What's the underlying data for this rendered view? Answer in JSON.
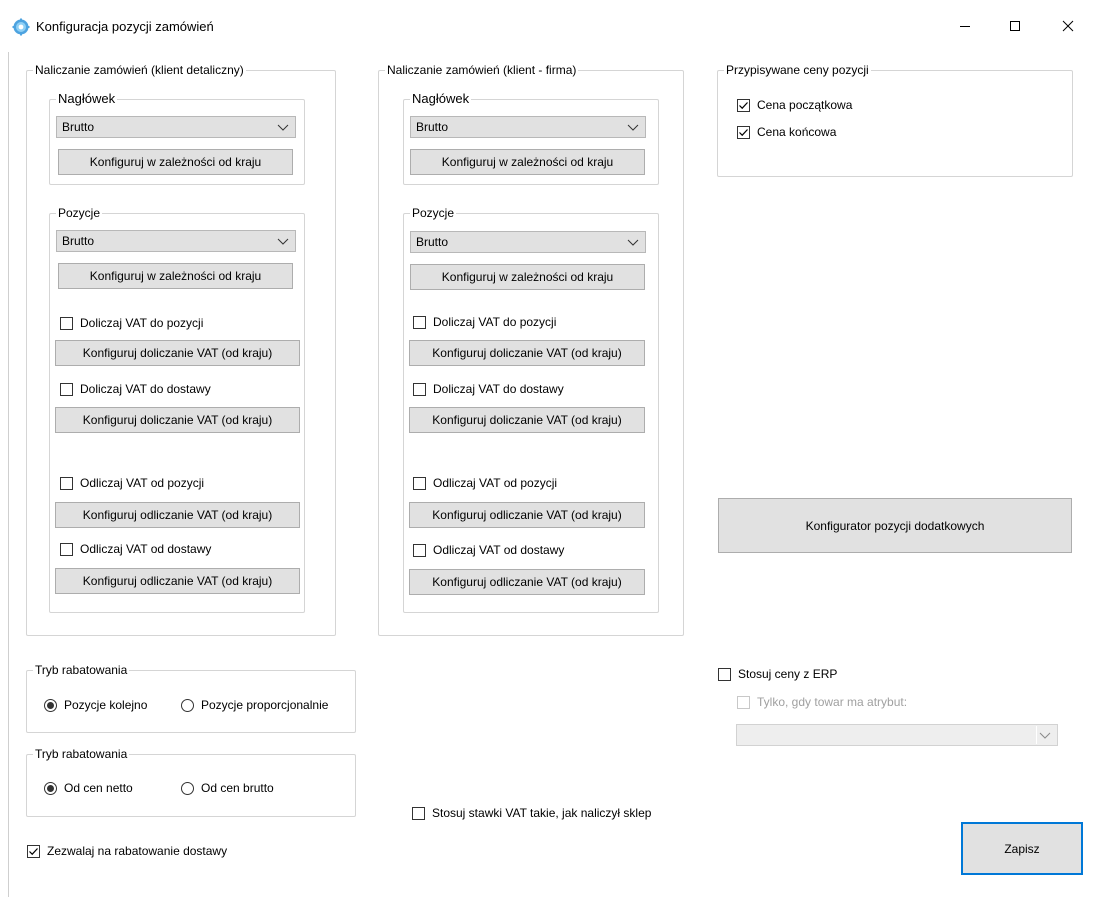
{
  "window": {
    "title": "Konfiguracja pozycji zamówień",
    "controls": {
      "minimize": "minimize-icon",
      "maximize": "maximize-icon",
      "close": "close-icon"
    },
    "icon": "gear-icon"
  },
  "retail": {
    "legend": "Naliczanie zamówień (klient detaliczny)",
    "header": {
      "legend": "Nagłówek",
      "select_value": "Brutto",
      "configure_label": "Konfiguruj w zależności od kraju"
    },
    "positions": {
      "legend": "Pozycje",
      "select_value": "Brutto",
      "configure_label": "Konfiguruj w zależności od kraju",
      "add_vat_positions_label": "Doliczaj VAT do pozycji",
      "add_vat_positions_checked": false,
      "add_vat_positions_button": "Konfiguruj doliczanie VAT (od kraju)",
      "add_vat_delivery_label": "Doliczaj VAT do dostawy",
      "add_vat_delivery_checked": false,
      "add_vat_delivery_button": "Konfiguruj doliczanie VAT (od kraju)",
      "sub_vat_positions_label": "Odliczaj VAT od pozycji",
      "sub_vat_positions_checked": false,
      "sub_vat_positions_button": "Konfiguruj odliczanie VAT (od kraju)",
      "sub_vat_delivery_label": "Odliczaj VAT od dostawy",
      "sub_vat_delivery_checked": false,
      "sub_vat_delivery_button": "Konfiguruj odliczanie VAT (od kraju)"
    }
  },
  "company": {
    "legend": "Naliczanie zamówień (klient - firma)",
    "header": {
      "legend": "Nagłówek",
      "select_value": "Brutto",
      "configure_label": "Konfiguruj w zależności od kraju"
    },
    "positions": {
      "legend": "Pozycje",
      "select_value": "Brutto",
      "configure_label": "Konfiguruj w zależności od kraju",
      "add_vat_positions_label": "Doliczaj VAT do pozycji",
      "add_vat_positions_checked": false,
      "add_vat_positions_button": "Konfiguruj doliczanie VAT (od kraju)",
      "add_vat_delivery_label": "Doliczaj VAT do dostawy",
      "add_vat_delivery_checked": false,
      "add_vat_delivery_button": "Konfiguruj doliczanie VAT (od kraju)",
      "sub_vat_positions_label": "Odliczaj VAT od pozycji",
      "sub_vat_positions_checked": false,
      "sub_vat_positions_button": "Konfiguruj odliczanie VAT (od kraju)",
      "sub_vat_delivery_label": "Odliczaj VAT od dostawy",
      "sub_vat_delivery_checked": false,
      "sub_vat_delivery_button": "Konfiguruj odliczanie VAT (od kraju)"
    }
  },
  "assigned_prices": {
    "legend": "Przypisywane ceny pozycji",
    "initial_price_label": "Cena początkowa",
    "initial_price_checked": true,
    "final_price_label": "Cena końcowa",
    "final_price_checked": true
  },
  "extra_positions_button": "Konfigurator pozycji dodatkowych",
  "discount_mode_1": {
    "legend": "Tryb rabatowania",
    "option_sequential": "Pozycje kolejno",
    "option_proportional": "Pozycje proporcjonalnie",
    "selected": "sequential"
  },
  "discount_mode_2": {
    "legend": "Tryb rabatowania",
    "option_net": "Od cen netto",
    "option_gross": "Od cen brutto",
    "selected": "net"
  },
  "allow_delivery_discount_label": "Zezwalaj na rabatowanie dostawy",
  "allow_delivery_discount_checked": true,
  "shop_vat_rates_label": "Stosuj stawki VAT takie, jak naliczył sklep",
  "shop_vat_rates_checked": false,
  "erp": {
    "use_erp_prices_label": "Stosuj ceny z ERP",
    "use_erp_prices_checked": false,
    "only_attribute_label": "Tylko, gdy towar ma atrybut:",
    "only_attribute_checked": false,
    "attribute_value": ""
  },
  "save_button": "Zapisz",
  "colors": {
    "accent": "#0078d7",
    "button_face": "#e1e1e1",
    "group_border": "#d5d5d5"
  }
}
